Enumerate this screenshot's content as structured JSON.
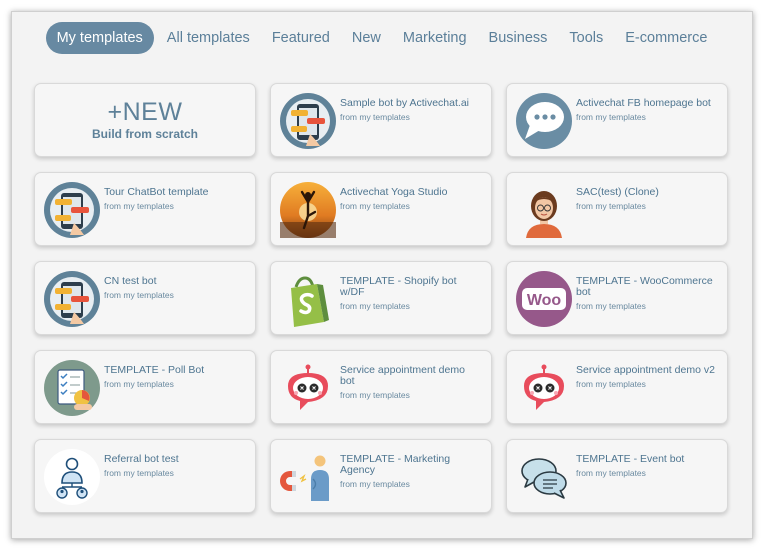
{
  "tabs": [
    {
      "label": "My templates",
      "active": true
    },
    {
      "label": "All templates",
      "active": false
    },
    {
      "label": "Featured",
      "active": false
    },
    {
      "label": "New",
      "active": false
    },
    {
      "label": "Marketing",
      "active": false
    },
    {
      "label": "Business",
      "active": false
    },
    {
      "label": "Tools",
      "active": false
    },
    {
      "label": "E-commerce",
      "active": false
    }
  ],
  "new_card": {
    "big": "+NEW",
    "small": "Build from scratch"
  },
  "cards": [
    {
      "title": "Sample bot by Activechat.ai",
      "sub": "from my templates",
      "icon": "phone-chat-icon"
    },
    {
      "title": "Activechat FB homepage bot",
      "sub": "from my templates",
      "icon": "chat-bubble-icon"
    },
    {
      "title": "Tour ChatBot template",
      "sub": "from my templates",
      "icon": "phone-chat-icon"
    },
    {
      "title": "Activechat Yoga Studio",
      "sub": "from my templates",
      "icon": "yoga-icon"
    },
    {
      "title": "SAC(test) (Clone)",
      "sub": "from my templates",
      "icon": "woman-avatar-icon"
    },
    {
      "title": "CN test bot",
      "sub": "from my templates",
      "icon": "phone-chat-icon"
    },
    {
      "title": "TEMPLATE - Shopify bot w/DF",
      "sub": "from my templates",
      "icon": "shopify-icon"
    },
    {
      "title": "TEMPLATE - WooCommerce bot",
      "sub": "from my templates",
      "icon": "woocommerce-icon"
    },
    {
      "title": "TEMPLATE - Poll Bot",
      "sub": "from my templates",
      "icon": "poll-icon"
    },
    {
      "title": "Service appointment demo bot",
      "sub": "from my templates",
      "icon": "robot-icon"
    },
    {
      "title": "Service appointment demo v2",
      "sub": "from my templates",
      "icon": "robot-icon"
    },
    {
      "title": "Referral bot test",
      "sub": "from my templates",
      "icon": "referral-icon"
    },
    {
      "title": "TEMPLATE - Marketing Agency",
      "sub": "from my templates",
      "icon": "magnet-icon"
    },
    {
      "title": "TEMPLATE - Event bot",
      "sub": "from my templates",
      "icon": "chat-bubbles-icon"
    }
  ],
  "woo_text": "Woo",
  "colors": {
    "accent": "#6789a2",
    "text": "#4e7590",
    "background": "#f3f3f3",
    "card": "#f6f6f6"
  }
}
